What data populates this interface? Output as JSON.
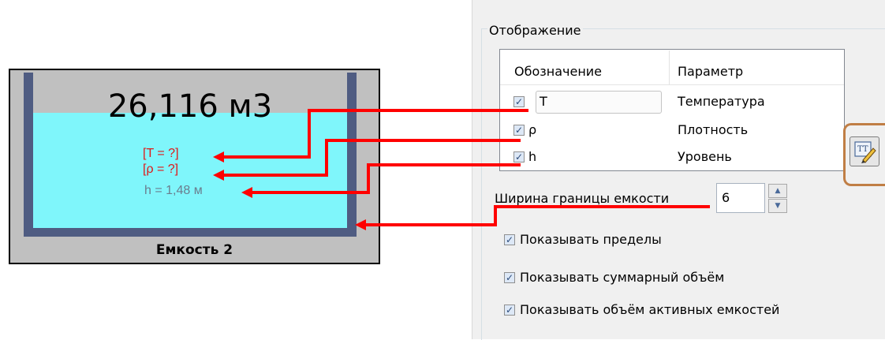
{
  "tank": {
    "volume": "26,116 м3",
    "name": "Емкость 2",
    "labels": {
      "t": "[T = ?]",
      "rho": "[ρ = ?]",
      "h": "h = 1,48 м"
    }
  },
  "panel": {
    "group_title": "Отображение",
    "columns": {
      "symbol": "Обозначение",
      "parameter": "Параметр"
    },
    "rows": [
      {
        "checked": true,
        "symbol": "T",
        "parameter": "Температура"
      },
      {
        "checked": true,
        "symbol": "ρ",
        "parameter": "Плотность"
      },
      {
        "checked": true,
        "symbol": "h",
        "parameter": "Уровень"
      }
    ],
    "border_width_label": "Ширина границы емкости",
    "border_width_value": "6",
    "options": [
      {
        "checked": true,
        "label": "Показывать пределы"
      },
      {
        "checked": true,
        "label": "Показывать суммарный объём"
      },
      {
        "checked": true,
        "label": "Показывать объём активных емкостей"
      }
    ]
  },
  "colors": {
    "arrow": "#ff0000",
    "liquid": "#7ff6fb",
    "tank_wall": "#4f5c82",
    "tank_body": "#c0c0c0",
    "highlight": "#c07e45"
  },
  "icons": {
    "edit_label_button": "text-edit-pencil-icon",
    "check": "checkmark-icon"
  }
}
